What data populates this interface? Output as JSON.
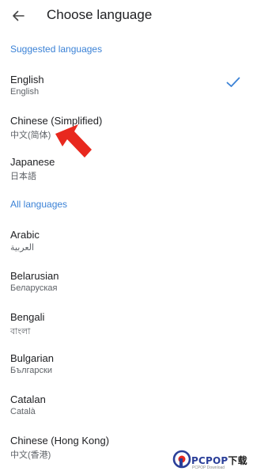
{
  "header": {
    "title": "Choose language",
    "back_icon": "arrow-left-icon"
  },
  "sections": {
    "suggested": "Suggested languages",
    "all": "All languages"
  },
  "suggested_languages": [
    {
      "name": "English",
      "native": "English",
      "selected": true
    },
    {
      "name": "Chinese (Simplified)",
      "native": "中文(简体)",
      "selected": false
    },
    {
      "name": "Japanese",
      "native": "日本語",
      "selected": false
    }
  ],
  "all_languages": [
    {
      "name": "Arabic",
      "native": "العربية"
    },
    {
      "name": "Belarusian",
      "native": "Беларуская"
    },
    {
      "name": "Bengali",
      "native": "বাংলা"
    },
    {
      "name": "Bulgarian",
      "native": "Български"
    },
    {
      "name": "Catalan",
      "native": "Català"
    },
    {
      "name": "Chinese (Hong Kong)",
      "native": "中文(香港)"
    }
  ],
  "watermark": {
    "brand_pc": "PC",
    "brand_pop": "POP",
    "brand_dl": "下载",
    "sub": "PCPOP Download"
  },
  "colors": {
    "accent": "#3b82d6",
    "annotation_arrow": "#e8281e"
  }
}
